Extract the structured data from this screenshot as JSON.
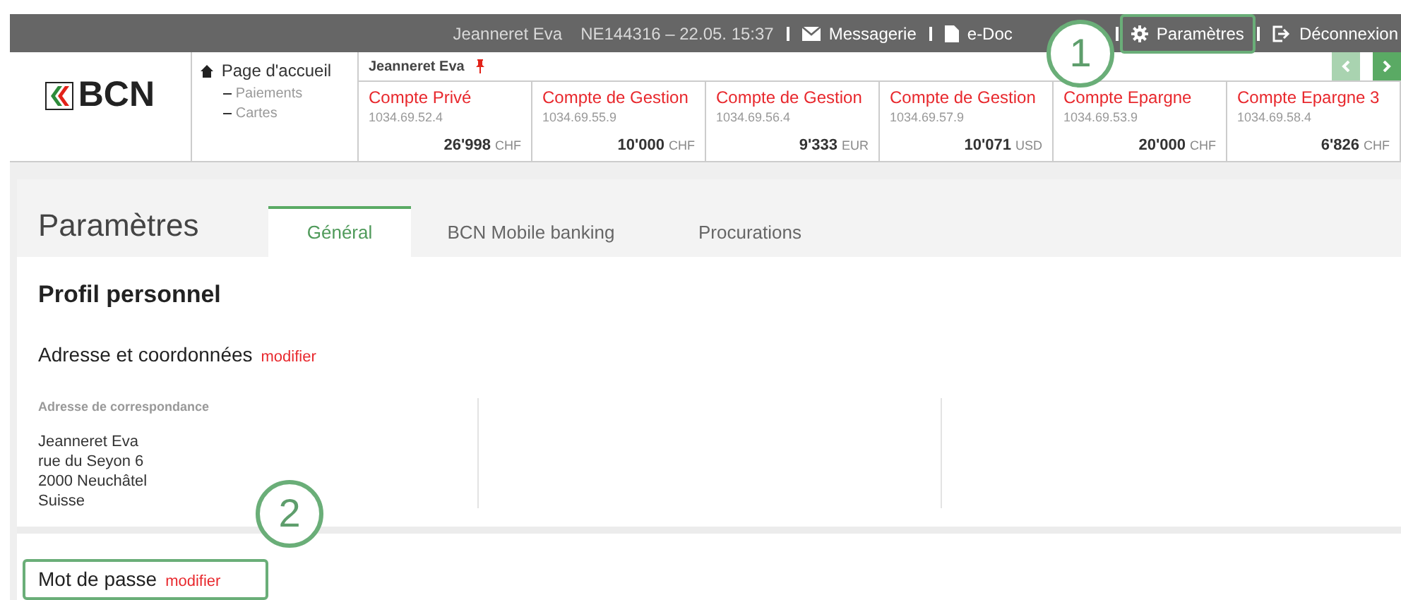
{
  "top_bar": {
    "user": "Jeanneret Eva",
    "session": "NE144316 – 22.05. 15:37",
    "links": [
      {
        "kind": "mail",
        "label": "Messagerie"
      },
      {
        "kind": "document",
        "label": "e-Doc"
      },
      {
        "kind": "settings",
        "label": "Paramètres"
      },
      {
        "kind": "logout",
        "label": "Déconnexion"
      }
    ]
  },
  "logo": {
    "text": "BCN"
  },
  "nav": {
    "home": "Page d'accueil",
    "items": [
      "Paiements",
      "Cartes"
    ]
  },
  "accounts_header": {
    "owner": "Jeanneret Eva",
    "pinned": true
  },
  "pager": [
    {
      "kind": "prev",
      "disabled": true
    },
    {
      "kind": "next",
      "disabled": false
    }
  ],
  "accounts": [
    {
      "name": "Compte Privé",
      "number": "1034.69.52.4",
      "amount": "26'998",
      "currency": "CHF"
    },
    {
      "name": "Compte de Gestion",
      "number": "1034.69.55.9",
      "amount": "10'000",
      "currency": "CHF"
    },
    {
      "name": "Compte de Gestion",
      "number": "1034.69.56.4",
      "amount": "9'333",
      "currency": "EUR"
    },
    {
      "name": "Compte de Gestion",
      "number": "1034.69.57.9",
      "amount": "10'071",
      "currency": "USD"
    },
    {
      "name": "Compte Epargne",
      "number": "1034.69.53.9",
      "amount": "20'000",
      "currency": "CHF"
    },
    {
      "name": "Compte Epargne 3",
      "number": "1034.69.58.4",
      "amount": "6'826",
      "currency": "CHF"
    }
  ],
  "page_title": "Paramètres",
  "tabs": [
    {
      "label": "Général",
      "selected": true
    },
    {
      "label": "BCN Mobile banking",
      "selected": false
    },
    {
      "label": "Procurations",
      "selected": false
    }
  ],
  "profile": {
    "title": "Profil personnel",
    "address_section": {
      "title": "Adresse et coordonnées",
      "link": "modifier"
    },
    "address": {
      "label": "Adresse de correspondance",
      "lines": [
        "Jeanneret Eva",
        "rue du Seyon 6",
        "2000 Neuchâtel",
        "Suisse"
      ]
    }
  },
  "password_section": {
    "title": "Mot de passe",
    "link": "modifier"
  },
  "annotations": [
    {
      "number": "1"
    },
    {
      "number": "2"
    }
  ]
}
